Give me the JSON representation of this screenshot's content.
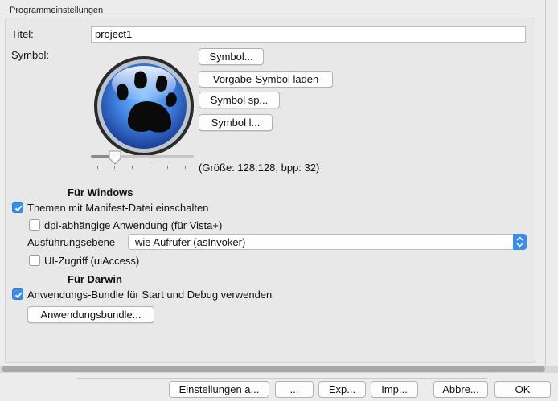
{
  "group": {
    "title": "Programmeinstellungen"
  },
  "title_row": {
    "label": "Titel:",
    "value": "project1"
  },
  "symbol_row": {
    "label": "Symbol:",
    "buttons": [
      "Symbol...",
      "Vorgabe-Symbol laden",
      "Symbol sp...",
      "Symbol l..."
    ],
    "size_info": "(Größe: 128:128, bpp: 32)",
    "slider_value_fraction": 0.25
  },
  "windows": {
    "heading": "Für Windows",
    "manifest_label": "Themen mit Manifest-Datei einschalten",
    "manifest_checked": true,
    "dpi_label": "dpi-abhängige Anwendung (für Vista+)",
    "dpi_checked": false,
    "exec_level_label": "Ausführungsebene",
    "exec_level_value": "wie Aufrufer (asInvoker)",
    "uiaccess_label": "UI-Zugriff (uiAccess)",
    "uiaccess_checked": false
  },
  "darwin": {
    "heading": "Für Darwin",
    "bundle_label": "Anwendungs-Bundle für Start und Debug verwenden",
    "bundle_checked": true,
    "bundle_button": "Anwendungsbundle..."
  },
  "bottom_buttons": [
    "Einstellungen a...",
    "...",
    "Exp...",
    "Imp...",
    "Abbre...",
    "OK"
  ],
  "colors": {
    "accent": "#3a8ee8"
  }
}
